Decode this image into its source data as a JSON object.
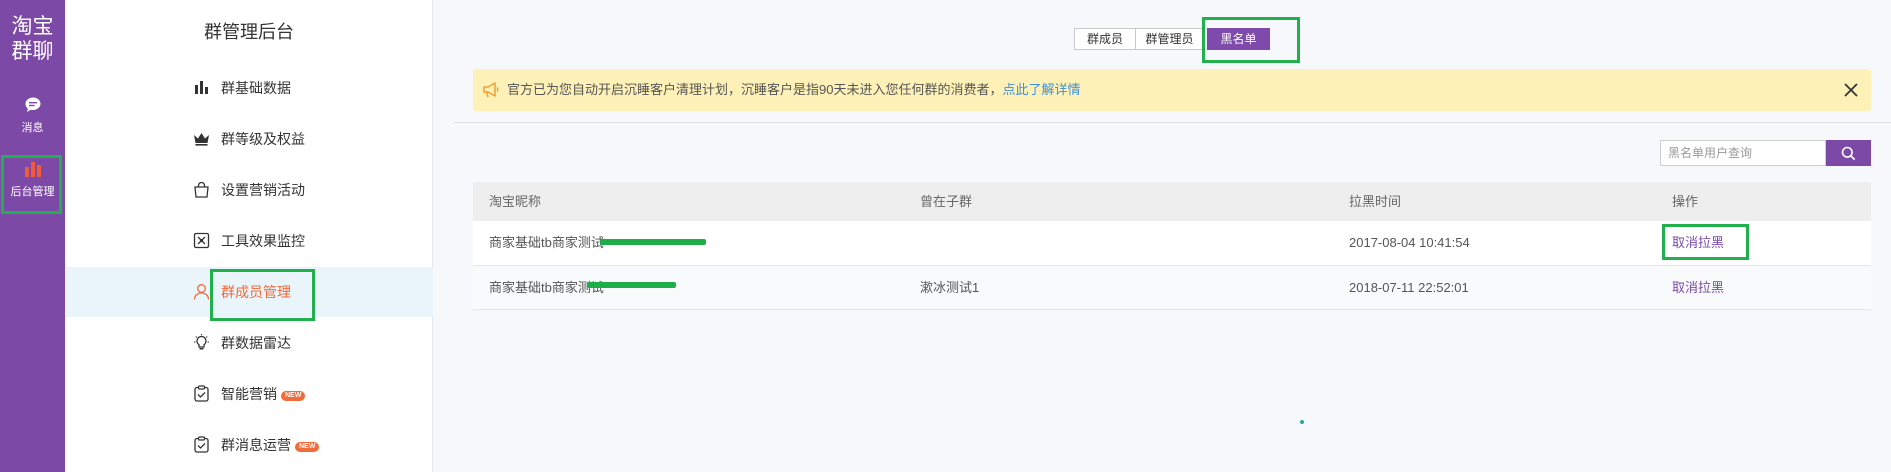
{
  "colors": {
    "brand_purple": "#7c4aa6",
    "link_blue": "#3d8fd9",
    "accent_orange": "#f26b3a",
    "notice_bg": "#fdf1b8",
    "highlight_green": "#21b04b"
  },
  "rail": {
    "logo_line1": "淘宝",
    "logo_line2": "群聊",
    "items": [
      {
        "label": "消息",
        "icon": "chat-bubble-icon"
      },
      {
        "label": "后台管理",
        "icon": "bar-chart-icon",
        "active": true
      }
    ]
  },
  "menu": {
    "title": "群管理后台",
    "items": [
      {
        "label": "群基础数据",
        "icon": "bar-chart-icon"
      },
      {
        "label": "群等级及权益",
        "icon": "crown-icon"
      },
      {
        "label": "设置营销活动",
        "icon": "shopping-bag-icon"
      },
      {
        "label": "工具效果监控",
        "icon": "monitor-box-icon"
      },
      {
        "label": "群成员管理",
        "icon": "user-icon",
        "active": true
      },
      {
        "label": "群数据雷达",
        "icon": "lightbulb-icon"
      },
      {
        "label": "智能营销",
        "icon": "clipboard-icon",
        "badge": "NEW"
      },
      {
        "label": "群消息运营",
        "icon": "clipboard-icon",
        "badge": "NEW"
      }
    ]
  },
  "tabs": [
    {
      "label": "群成员"
    },
    {
      "label": "群管理员"
    },
    {
      "label": "黑名单",
      "active": true
    }
  ],
  "notice": {
    "icon": "megaphone-icon",
    "text": "官方已为您自动开启沉睡客户清理计划，沉睡客户是指90天未进入您任何群的消费者，",
    "link": "点此了解详情",
    "close_icon": "close-icon"
  },
  "search": {
    "placeholder": "黑名单用户查询",
    "button_icon": "search-icon"
  },
  "table": {
    "headers": [
      "淘宝昵称",
      "曾在子群",
      "拉黑时间",
      "操作"
    ],
    "rows": [
      {
        "nickname": "商家基础tb商家测试",
        "subgroup": "",
        "time": "2017-08-04 10:41:54",
        "action": "取消拉黑"
      },
      {
        "nickname": "商家基础tb商家测试",
        "subgroup": "漱冰测试1",
        "time": "2018-07-11 22:52:01",
        "action": "取消拉黑"
      }
    ]
  }
}
